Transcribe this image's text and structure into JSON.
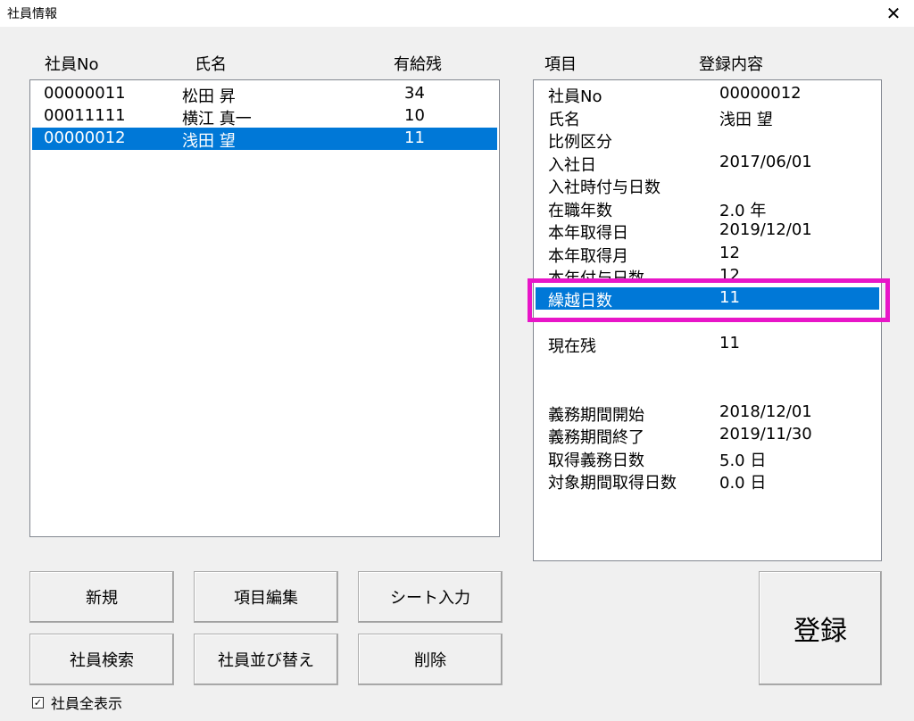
{
  "window": {
    "title": "社員情報",
    "close_glyph": "✕"
  },
  "employee_list": {
    "headers": {
      "no": "社員No",
      "name": "氏名",
      "paid_leave": "有給残"
    },
    "rows": [
      {
        "no": "00000011",
        "name": "松田 昇",
        "paid_leave": "34"
      },
      {
        "no": "00011111",
        "name": "横江 真一",
        "paid_leave": "10"
      },
      {
        "no": "00000012",
        "name": "浅田 望",
        "paid_leave": "11"
      }
    ],
    "selected_index": 2
  },
  "detail": {
    "headers": {
      "item": "項目",
      "content": "登録内容"
    },
    "rows": [
      {
        "label": "社員No",
        "value": "00000012"
      },
      {
        "label": "氏名",
        "value": "浅田 望"
      },
      {
        "label": "比例区分",
        "value": ""
      },
      {
        "label": "入社日",
        "value": "2017/06/01"
      },
      {
        "label": "入社時付与日数",
        "value": ""
      },
      {
        "label": "在職年数",
        "value": "2.0 年"
      },
      {
        "label": "本年取得日",
        "value": "2019/12/01"
      },
      {
        "label": "本年取得月",
        "value": "12"
      },
      {
        "label": "本年付与日数",
        "value": "12"
      },
      {
        "label": "繰越日数",
        "value": "11"
      },
      {
        "label": "現在残",
        "value": "11"
      },
      {
        "label": "義務期間開始",
        "value": "2018/12/01"
      },
      {
        "label": "義務期間終了",
        "value": "2019/11/30"
      },
      {
        "label": "取得義務日数",
        "value": "5.0 日"
      },
      {
        "label": "対象期間取得日数",
        "value": "0.0 日"
      }
    ],
    "selected_label": "繰越日数",
    "highlight_color": "#e815c8"
  },
  "buttons": {
    "new": "新規",
    "edit_items": "項目編集",
    "sheet_input": "シート入力",
    "search": "社員検索",
    "sort": "社員並び替え",
    "delete": "削除",
    "register": "登録"
  },
  "show_all": {
    "label": "社員全表示",
    "checked": true,
    "check_glyph": "✓"
  },
  "colors": {
    "selection": "#0078d7",
    "background": "#f0f0f0"
  }
}
